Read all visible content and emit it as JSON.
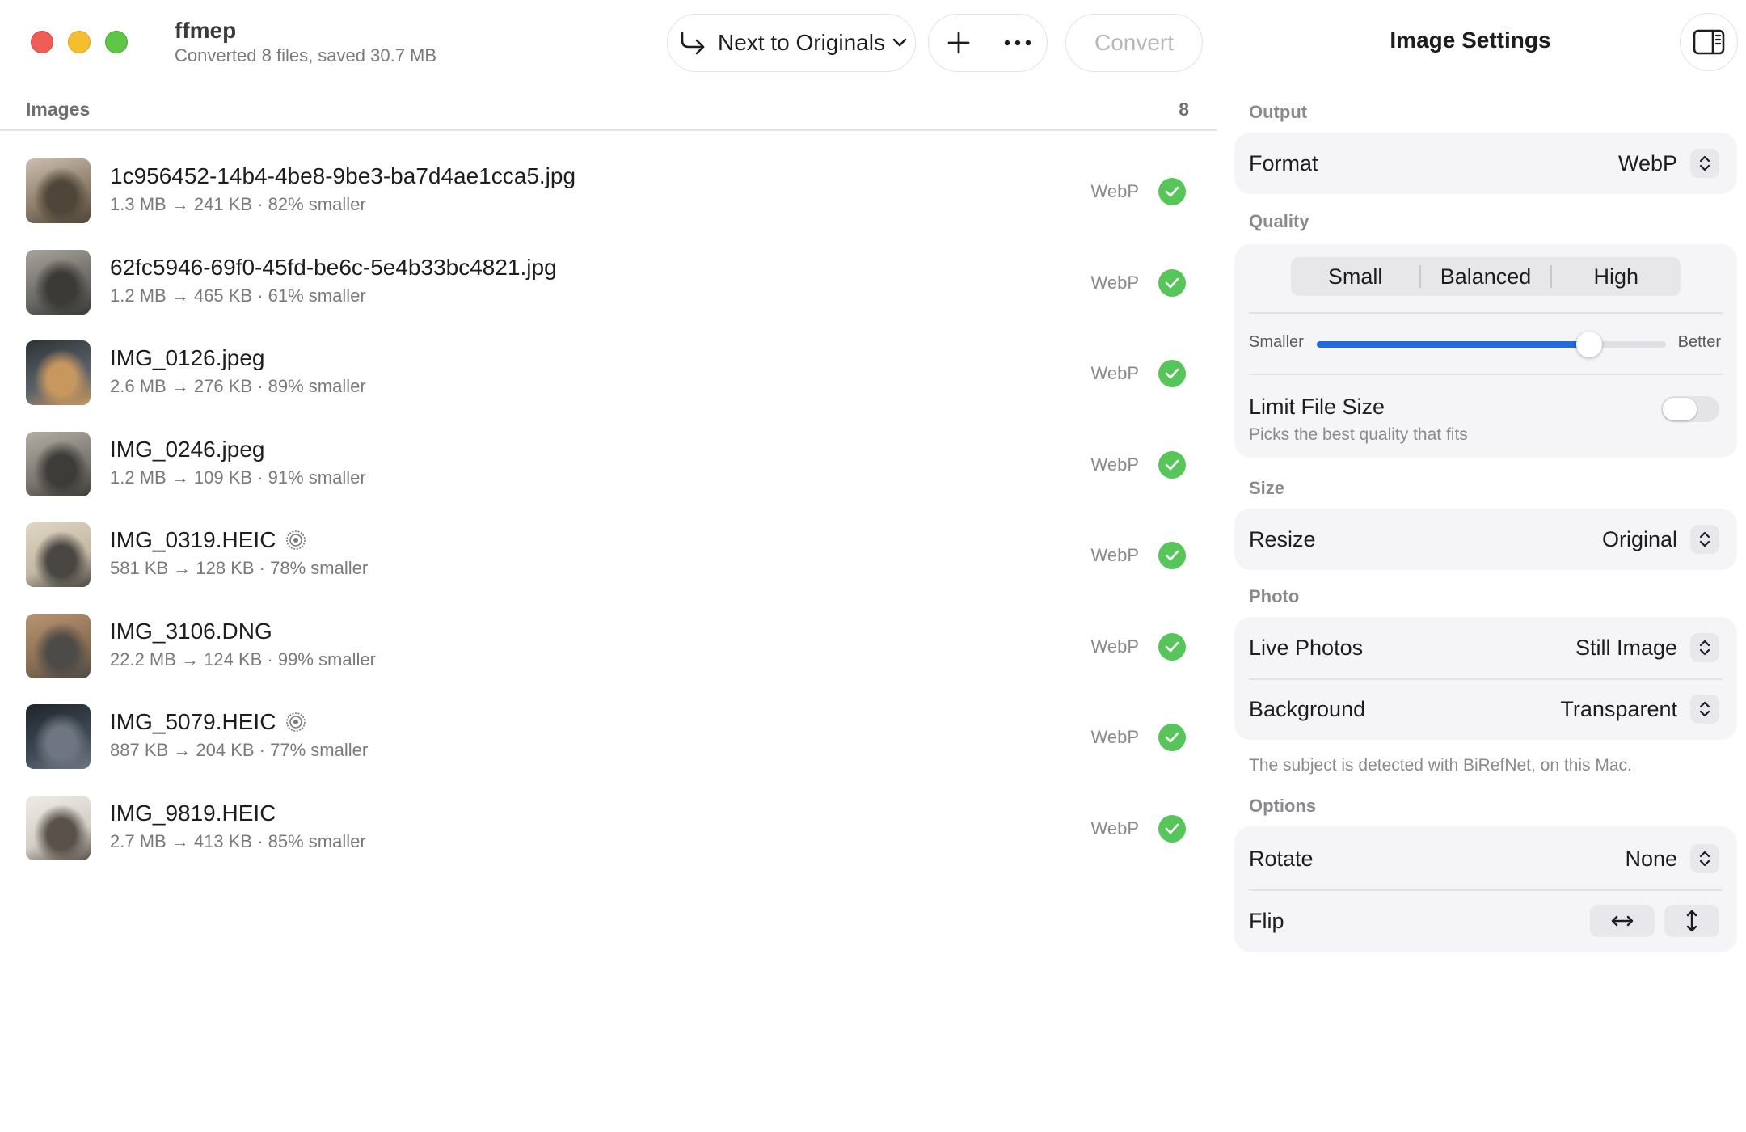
{
  "window": {
    "app_name": "ffmep",
    "status": "Converted 8 files, saved 30.7 MB"
  },
  "toolbar": {
    "destination_label": "Next to Originals",
    "convert_label": "Convert"
  },
  "list": {
    "header_title": "Images",
    "count": "8",
    "items": [
      {
        "name": "1c956452-14b4-4be8-9be3-ba7d4ae1cca5.jpg",
        "meta": "1.3 MB → 241 KB · 82% smaller",
        "format": "WebP",
        "live": false,
        "thumb": [
          "#8a7a68",
          "#4f4538",
          "#cbbfae"
        ]
      },
      {
        "name": "62fc5946-69f0-45fd-be6c-5e4b33bc4821.jpg",
        "meta": "1.2 MB → 465 KB · 61% smaller",
        "format": "WebP",
        "live": false,
        "thumb": [
          "#6c6a66",
          "#3b3a37",
          "#a8a49c"
        ]
      },
      {
        "name": "IMG_0126.jpeg",
        "meta": "2.6 MB → 276 KB · 89% smaller",
        "format": "WebP",
        "live": false,
        "thumb": [
          "#5b636b",
          "#c7975e",
          "#2e3236"
        ]
      },
      {
        "name": "IMG_0246.jpeg",
        "meta": "1.2 MB → 109 KB · 91% smaller",
        "format": "WebP",
        "live": false,
        "thumb": [
          "#7a7670",
          "#3e3c39",
          "#b3aea4"
        ]
      },
      {
        "name": "IMG_0319.HEIC",
        "meta": "581 KB → 128 KB · 78% smaller",
        "format": "WebP",
        "live": true,
        "thumb": [
          "#c3b8a3",
          "#4a4642",
          "#e0d6c4"
        ]
      },
      {
        "name": "IMG_3106.DNG",
        "meta": "22.2 MB → 124 KB · 99% smaller",
        "format": "WebP",
        "live": false,
        "thumb": [
          "#8b6e52",
          "#4d4a47",
          "#b89572"
        ]
      },
      {
        "name": "IMG_5079.HEIC",
        "meta": "887 KB → 204 KB · 77% smaller",
        "format": "WebP",
        "live": true,
        "thumb": [
          "#3f4a56",
          "#6f7681",
          "#1f242a"
        ]
      },
      {
        "name": "IMG_9819.HEIC",
        "meta": "2.7 MB → 413 KB · 85% smaller",
        "format": "WebP",
        "live": false,
        "thumb": [
          "#d3cfc7",
          "#5a524a",
          "#efece6"
        ]
      }
    ]
  },
  "inspector": {
    "title": "Image Settings",
    "output": {
      "label": "Output",
      "format_label": "Format",
      "format_value": "WebP"
    },
    "quality": {
      "label": "Quality",
      "options": [
        "Small",
        "Balanced",
        "High"
      ],
      "slider_min_label": "Smaller",
      "slider_max_label": "Better",
      "slider_value": 0.78,
      "limit_label": "Limit File Size",
      "limit_sub": "Picks the best quality that fits",
      "limit_on": false
    },
    "size": {
      "label": "Size",
      "resize_label": "Resize",
      "resize_value": "Original"
    },
    "photo": {
      "label": "Photo",
      "live_label": "Live Photos",
      "live_value": "Still Image",
      "background_label": "Background",
      "background_value": "Transparent",
      "note": "The subject is detected with BiRefNet, on this Mac."
    },
    "options": {
      "label": "Options",
      "rotate_label": "Rotate",
      "rotate_value": "None",
      "flip_label": "Flip"
    }
  },
  "colors": {
    "accent": "#1f6ce0",
    "success": "#57c55a",
    "close": "#ee5e57",
    "minimize": "#f5bd30",
    "zoom": "#5fc547"
  }
}
